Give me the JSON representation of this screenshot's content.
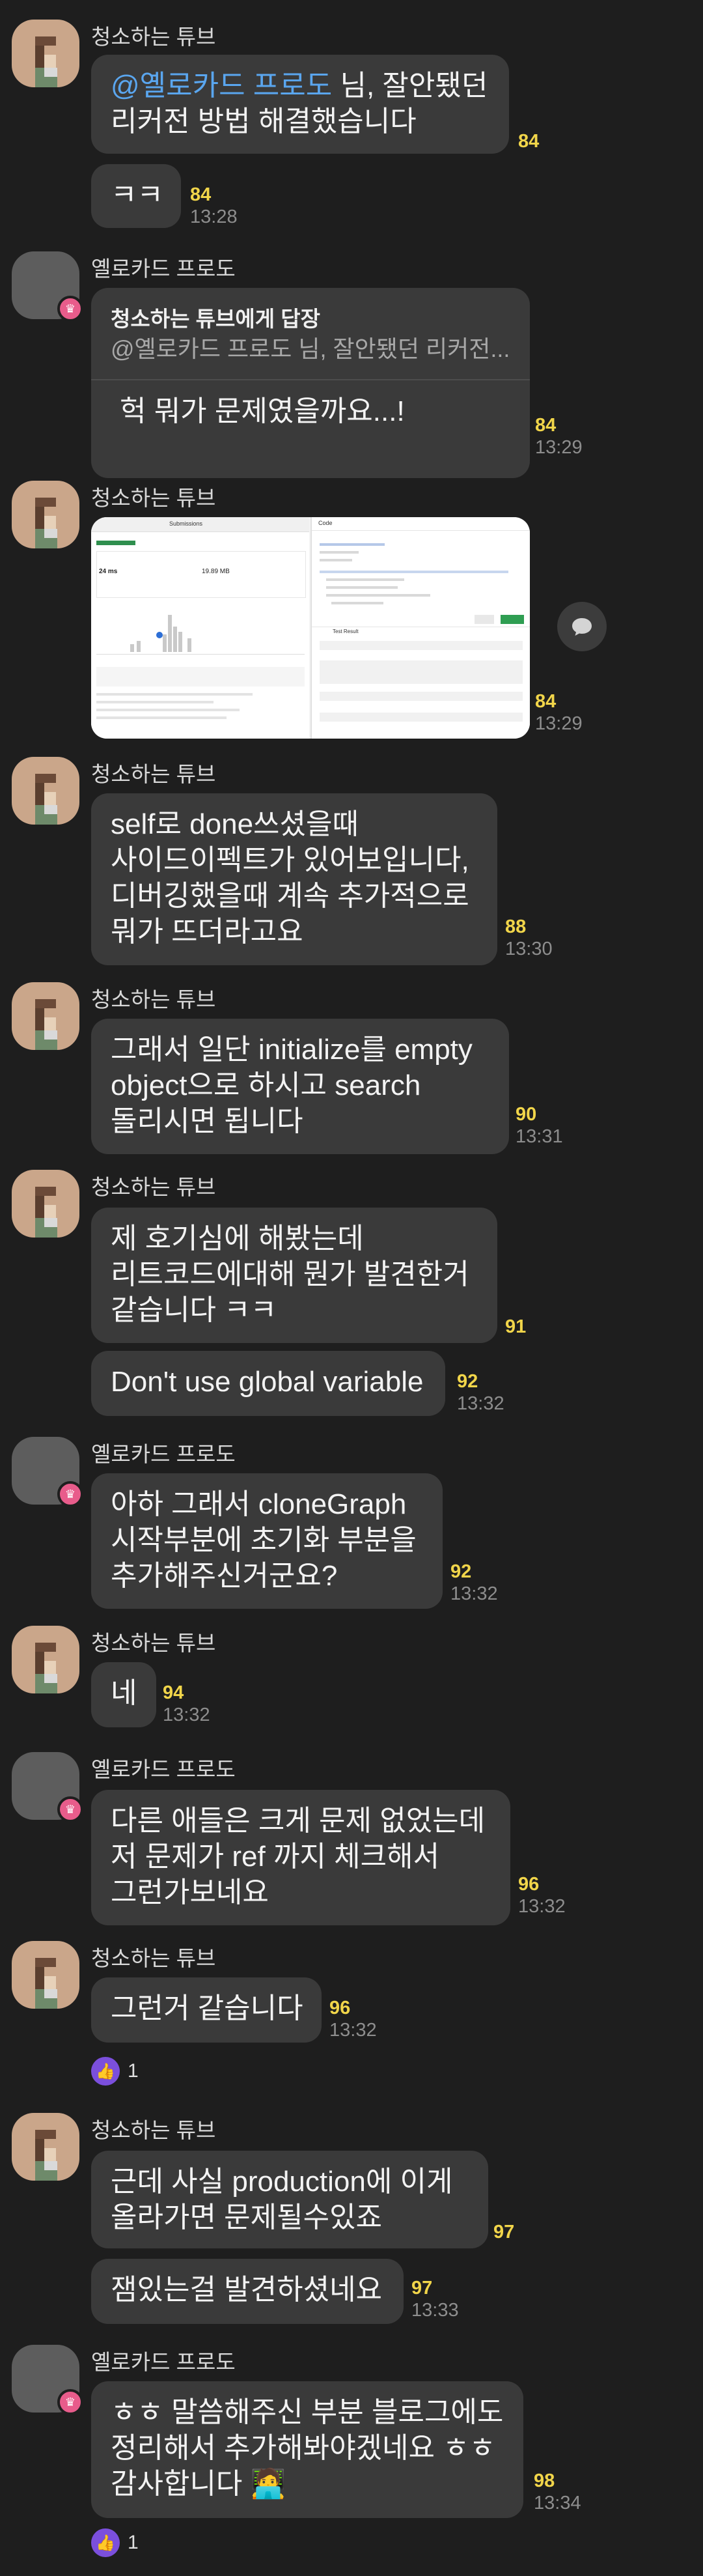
{
  "users": {
    "tube": "청소하는 튜브",
    "yellow": "옐로카드 프로도"
  },
  "messages": {
    "m1": {
      "mention": "@옐로카드 프로도",
      "line1_rest": " 님, 잘안됐던",
      "line2": "리커전 방법 해결했습니다",
      "count": "84"
    },
    "m2": {
      "text": "ㅋㅋ",
      "count": "84",
      "time": "13:28"
    },
    "m3": {
      "reply_title": "청소하는 튜브에게 답장",
      "reply_quote": "@옐로카드 프로도 님, 잘안됐던 리커전...",
      "text": "헉 뭐가 문제였을까요...!",
      "count": "84",
      "time": "13:29"
    },
    "m4": {
      "count": "84",
      "time": "13:29"
    },
    "m5": {
      "line1": "self로 done쓰셨을때",
      "line2": "사이드이펙트가 있어보입니다,",
      "line3": "디버깅했을때 계속 추가적으로",
      "line4": "뭐가 뜨더라고요",
      "count": "88",
      "time": "13:30"
    },
    "m6": {
      "line1": "그래서 일단 initialize를 empty",
      "line2": "object으로 하시고 search",
      "line3": "돌리시면 됩니다",
      "count": "90",
      "time": "13:31"
    },
    "m7": {
      "line1": "제 호기심에 해봤는데",
      "line2": "리트코드에대해 뭔가 발견한거",
      "line3": "같습니다 ㅋㅋ",
      "count": "91"
    },
    "m8": {
      "text": "Don't use global variable",
      "count": "92",
      "time": "13:32"
    },
    "m9": {
      "line1": "아하 그래서 cloneGraph",
      "line2": "시작부분에 초기화 부분을",
      "line3": "추가해주신거군요?",
      "count": "92",
      "time": "13:32"
    },
    "m10": {
      "text": "네",
      "count": "94",
      "time": "13:32"
    },
    "m11": {
      "line1": "다른 애들은 크게 문제 없었는데",
      "line2": "저 문제가 ref 까지 체크해서",
      "line3": "그런가보네요",
      "count": "96",
      "time": "13:32"
    },
    "m12": {
      "text": "그런거 같습니다",
      "count": "96",
      "time": "13:32",
      "reaction_count": "1"
    },
    "m13": {
      "line1": "근데 사실 production에 이게",
      "line2": "올라가면 문제될수있죠",
      "count": "97"
    },
    "m14": {
      "text": "잼있는걸 발견하셨네요",
      "count": "97",
      "time": "13:33"
    },
    "m15": {
      "line1": "ㅎㅎ 말씀해주신 부분 블로그에도",
      "line2": "정리해서 추가해봐야겠네요 ㅎㅎ",
      "line3": "감사합니다",
      "emoji": "🧑‍💻",
      "count": "98",
      "time": "13:34",
      "reaction_count": "1"
    }
  },
  "screenshot": {
    "left_tab": "Submissions",
    "right_title": "Code",
    "test_tab": "Test Result",
    "stat_runtime": "24 ms",
    "stat_memory": "19.89 MB"
  },
  "icons": {
    "share": "share-icon",
    "thumb": "thumbs-up-icon",
    "crown": "crown-icon"
  },
  "colors": {
    "background": "#1e1e1e",
    "bubble": "#3a3a3a",
    "count": "#f1d54a",
    "mention": "#5aa6ef",
    "reaction": "#7b4fdc"
  }
}
